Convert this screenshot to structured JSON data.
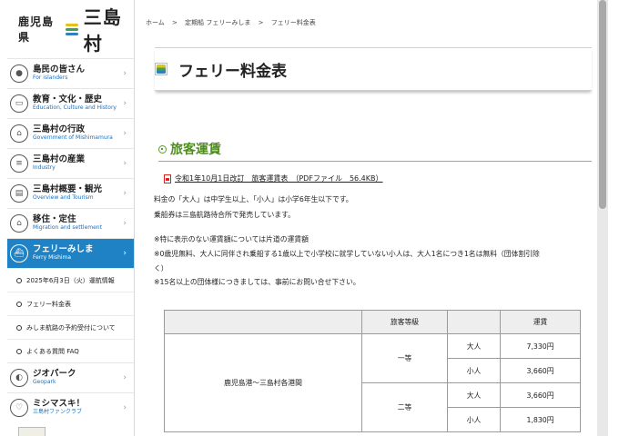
{
  "logo": {
    "prefix": "鹿児島県",
    "name": "三島村"
  },
  "nav": [
    {
      "icon": "people-icon",
      "jp": "島民の皆さん",
      "en": "For islanders"
    },
    {
      "icon": "book-icon",
      "jp": "教育・文化・歴史",
      "en": "Education, Culture and History"
    },
    {
      "icon": "government-icon",
      "jp": "三島村の行政",
      "en": "Government of Mishimamura"
    },
    {
      "icon": "industry-icon",
      "jp": "三島村の産業",
      "en": "Industry"
    },
    {
      "icon": "tourism-icon",
      "jp": "三島村概要・観光",
      "en": "Overview and Tourism"
    },
    {
      "icon": "house-icon",
      "jp": "移住・定住",
      "en": "Migration and settlement"
    },
    {
      "icon": "ferry-icon",
      "jp": "フェリーみしま",
      "en": "Ferry Mishima",
      "active": true
    }
  ],
  "subnav": [
    "2025年6月3日（火）運航情報",
    "フェリー料金表",
    "みしま航路の予約受付について",
    "よくある質問 FAQ"
  ],
  "nav2": [
    {
      "icon": "geopark-icon",
      "jp": "ジオパーク",
      "en": "Geopark"
    },
    {
      "icon": "club-icon",
      "jp": "ミシマスキ！",
      "en": "三島村ファンクラブ"
    }
  ],
  "breadcrumb": [
    "ホーム",
    ">",
    "定期船 フェリーみしま",
    ">",
    "フェリー料金表"
  ],
  "page_title": "フェリー料金表",
  "section_title": "旅客運賃",
  "pdf_link": "令和1年10月1日改訂　旅客運賃表　（PDFファイル　56.4KB）",
  "paragraphs": {
    "p1": "料金の「大人」は中学生以上、「小人」は小学6年生以下です。",
    "p2": "乗船券は三島航路待合所で発売しています。",
    "p3": "※特に表示のない運賃額については片道の運賃額",
    "p4": "※0歳児無料、大人に同伴され乗船する1歳以上で小学校に就学していない小人は、大人1名につき1名は無料（団体割引除",
    "p5": "く）",
    "p6": "※15名以上の団体様につきましては、事前にお問い合せ下さい。"
  },
  "fare_table": {
    "headers": [
      "",
      "旅客等級",
      "",
      "運賃"
    ],
    "route": "鹿児島港～三島村各港間",
    "classes": [
      {
        "name": "一等",
        "rows": [
          {
            "type": "大人",
            "fare": "7,330円"
          },
          {
            "type": "小人",
            "fare": "3,660円"
          }
        ]
      },
      {
        "name": "二等",
        "rows": [
          {
            "type": "大人",
            "fare": "3,660円"
          },
          {
            "type": "小人",
            "fare": "1,830円"
          }
        ]
      }
    ]
  }
}
